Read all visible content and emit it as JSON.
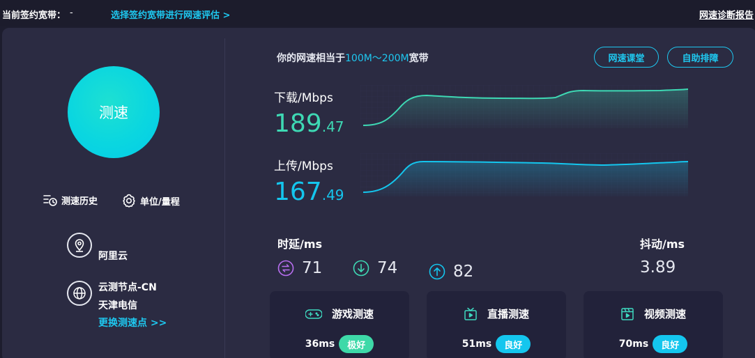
{
  "topbar": {
    "bandwidth_label": "当前签约宽带：",
    "bandwidth_value": "-",
    "select_link": "选择签约宽带进行网速评估 >",
    "report_link": "网速诊断报告"
  },
  "left": {
    "speed_button": "测速",
    "history": "测速历史",
    "units": "单位/量程",
    "provider": "阿里云",
    "node_name": "云测节点-CN",
    "node_isp": "天津电信",
    "change_node": "更换测速点 >>"
  },
  "equivalent": {
    "prefix": "你的网速相当于",
    "range": "100M～200M",
    "suffix": "宽带"
  },
  "buttons": {
    "course": "网速课堂",
    "self_help": "自助排障"
  },
  "download": {
    "label": "下载/Mbps",
    "int": "189",
    "dec": ".47"
  },
  "upload": {
    "label": "上传/Mbps",
    "int": "167",
    "dec": ".49"
  },
  "latency": {
    "title": "时延/ms",
    "avg": "71",
    "down": "74",
    "up": "82"
  },
  "jitter": {
    "title": "抖动/ms",
    "value": "3.89"
  },
  "tests": [
    {
      "title": "游戏测速",
      "ms": "36ms",
      "rating": "极好"
    },
    {
      "title": "直播测速",
      "ms": "51ms",
      "rating": "良好"
    },
    {
      "title": "视频测速",
      "ms": "70ms",
      "rating": "良好"
    }
  ],
  "colors": {
    "download": "#3ed9b4",
    "upload": "#14c6ee",
    "accent": "#1ec8f0",
    "card_bg": "#2b2b42"
  }
}
